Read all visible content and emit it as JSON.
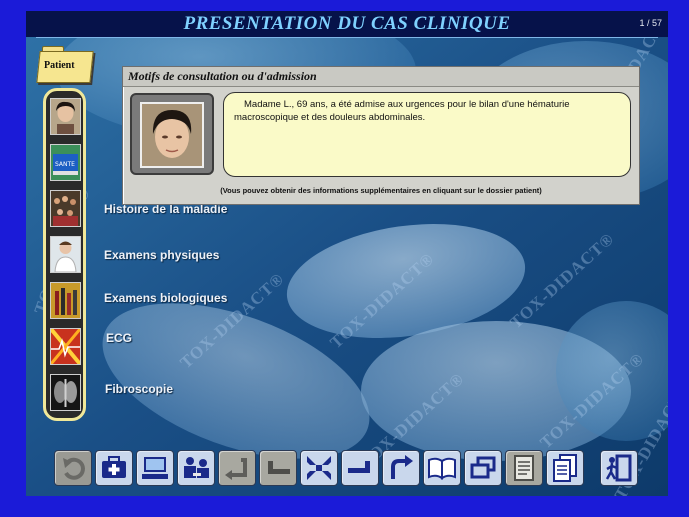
{
  "header": {
    "title": "PRESENTATION DU CAS CLINIQUE",
    "page_counter": "1 / 57"
  },
  "watermark_text": "TOX-DIDACT®",
  "folder": {
    "label": "Patient"
  },
  "nav_items": [
    {
      "label": "",
      "icon": "patient-portrait-icon"
    },
    {
      "label": "",
      "icon": "sante-card-icon"
    },
    {
      "label": "Histoire de la maladie",
      "icon": "group-photo-icon"
    },
    {
      "label": "Examens physiques",
      "icon": "doctor-icon"
    },
    {
      "label": "Examens biologiques",
      "icon": "test-tubes-icon"
    },
    {
      "label": "ECG",
      "icon": "ecg-icon"
    },
    {
      "label": "Fibroscopie",
      "icon": "xray-icon"
    }
  ],
  "dialog": {
    "title": "Motifs de consultation ou d'admission",
    "message": "Madame L., 69 ans, a été admise aux urgences  pour le bilan d'une hématurie macroscopique et des douleurs abdominales.",
    "note": "(Vous pouvez obtenir des informations supplémentaires en cliquant sur le dossier patient)",
    "thumb_label": "SANTE"
  },
  "toolbar": [
    {
      "icon": "undo-arrow-icon",
      "state": "disabled"
    },
    {
      "icon": "medical-kit-icon",
      "state": "active"
    },
    {
      "icon": "computer-icon",
      "state": "active"
    },
    {
      "icon": "consultation-icon",
      "state": "active"
    },
    {
      "icon": "return-arrow-icon",
      "state": "disabled"
    },
    {
      "icon": "back-step-icon",
      "state": "disabled"
    },
    {
      "icon": "shrink-arrows-icon",
      "state": "active"
    },
    {
      "icon": "forward-step-icon",
      "state": "active"
    },
    {
      "icon": "redo-arrow-icon",
      "state": "active"
    },
    {
      "icon": "book-icon",
      "state": "active"
    },
    {
      "icon": "windows-icon",
      "state": "active"
    },
    {
      "icon": "document-icon",
      "state": "disabled"
    },
    {
      "icon": "documents-icon",
      "state": "active"
    },
    {
      "icon": "exit-door-icon",
      "state": "active"
    }
  ],
  "colors": {
    "frame": "#1b1bd8",
    "title": "#7fd1ff",
    "message_bg": "#fafac8",
    "nav_border": "#f0e89a"
  }
}
